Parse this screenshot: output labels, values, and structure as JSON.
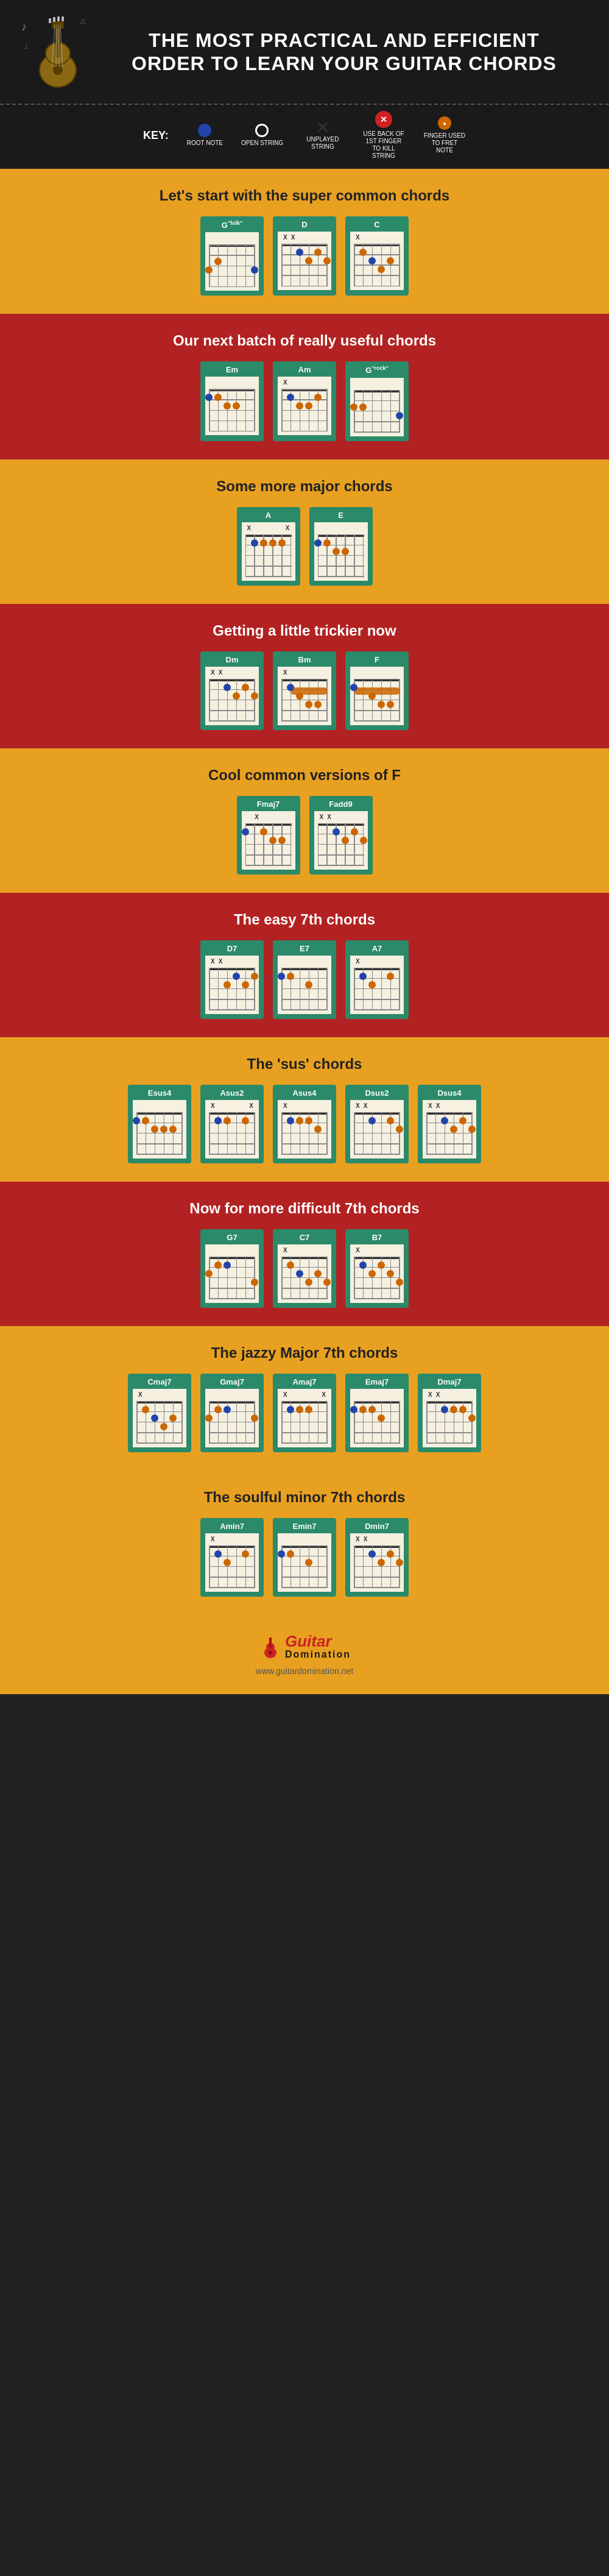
{
  "header": {
    "title": "THE MOST PRACTICAL AND EFFICIENT ORDER TO LEARN YOUR GUITAR CHORDS"
  },
  "key": {
    "label": "KEY:",
    "items": [
      {
        "id": "root-note",
        "type": "root",
        "label": "ROOT NOTE"
      },
      {
        "id": "open-string",
        "type": "open",
        "label": "OPEN STRING"
      },
      {
        "id": "unplayed",
        "type": "x",
        "label": "UNPLAYED STRING"
      },
      {
        "id": "kill-string",
        "type": "kill",
        "label": "USE BACK OF 1ST FINGER TO KILL STRING"
      },
      {
        "id": "fret-note",
        "type": "fret",
        "label": "FINGER USED TO FRET NOTE"
      }
    ]
  },
  "sections": [
    {
      "id": "super-common",
      "bg": "yellow",
      "title": "Let's start with the super common chords",
      "chords": [
        {
          "name": "G",
          "sup": "\"folk\"",
          "indicators": [
            "",
            "",
            "",
            "",
            "",
            ""
          ],
          "dots": []
        },
        {
          "name": "D",
          "sup": "",
          "indicators": [
            "X",
            "X",
            "",
            "",
            "",
            ""
          ],
          "dots": []
        },
        {
          "name": "C",
          "sup": "",
          "indicators": [
            "X",
            "",
            "",
            "",
            "",
            ""
          ],
          "dots": []
        }
      ]
    },
    {
      "id": "useful",
      "bg": "red",
      "title": "Our next batch of really useful chords",
      "chords": [
        {
          "name": "Em",
          "sup": "",
          "indicators": [
            "",
            "",
            "",
            "",
            "",
            ""
          ],
          "dots": []
        },
        {
          "name": "Am",
          "sup": "",
          "indicators": [
            "X",
            "",
            "",
            "",
            "",
            ""
          ],
          "dots": []
        },
        {
          "name": "G",
          "sup": "\"rock\"",
          "indicators": [
            "",
            "",
            "",
            "",
            "",
            ""
          ],
          "dots": []
        }
      ]
    },
    {
      "id": "major",
      "bg": "yellow",
      "title": "Some more major chords",
      "chords": [
        {
          "name": "A",
          "sup": "",
          "indicators": [
            "X",
            "",
            "",
            "",
            "",
            "X"
          ],
          "dots": []
        },
        {
          "name": "E",
          "sup": "",
          "indicators": [
            "",
            "",
            "",
            "",
            "",
            ""
          ],
          "dots": []
        }
      ]
    },
    {
      "id": "trickier",
      "bg": "red",
      "title": "Getting a little trickier now",
      "chords": [
        {
          "name": "Dm",
          "sup": "",
          "indicators": [
            "X",
            "X",
            "",
            "",
            "",
            ""
          ],
          "dots": []
        },
        {
          "name": "Bm",
          "sup": "",
          "indicators": [
            "X",
            "",
            "",
            "",
            "",
            ""
          ],
          "dots": []
        },
        {
          "name": "F",
          "sup": "",
          "indicators": [
            "",
            "",
            "",
            "",
            "",
            ""
          ],
          "dots": []
        }
      ]
    },
    {
      "id": "f-versions",
      "bg": "yellow",
      "title": "Cool common versions of F",
      "chords": [
        {
          "name": "Fmaj7",
          "sup": "",
          "indicators": [
            "",
            "X",
            "",
            "",
            "",
            ""
          ],
          "dots": []
        },
        {
          "name": "Fadd9",
          "sup": "",
          "indicators": [
            "X",
            "X",
            "",
            "",
            "",
            ""
          ],
          "dots": []
        }
      ]
    },
    {
      "id": "seventh",
      "bg": "red",
      "title": "The easy 7th chords",
      "chords": [
        {
          "name": "D7",
          "sup": "",
          "indicators": [
            "X",
            "X",
            "",
            "",
            "",
            ""
          ],
          "dots": []
        },
        {
          "name": "E7",
          "sup": "",
          "indicators": [
            "",
            "",
            "",
            "",
            "",
            ""
          ],
          "dots": []
        },
        {
          "name": "A7",
          "sup": "",
          "indicators": [
            "X",
            "",
            "",
            "",
            "",
            ""
          ],
          "dots": []
        }
      ]
    },
    {
      "id": "sus",
      "bg": "yellow",
      "title": "The 'sus' chords",
      "chords": [
        {
          "name": "Esus4",
          "sup": "",
          "indicators": [
            "",
            "",
            "",
            "",
            "",
            ""
          ],
          "dots": []
        },
        {
          "name": "Asus2",
          "sup": "",
          "indicators": [
            "X",
            "",
            "",
            "",
            "",
            "X"
          ],
          "dots": []
        },
        {
          "name": "Asus4",
          "sup": "",
          "indicators": [
            "X",
            "",
            "",
            "",
            "",
            ""
          ],
          "dots": []
        },
        {
          "name": "Dsus2",
          "sup": "",
          "indicators": [
            "X",
            "X",
            "",
            "",
            "",
            ""
          ],
          "dots": []
        },
        {
          "name": "Dsus4",
          "sup": "",
          "indicators": [
            "X",
            "X",
            "",
            "",
            "",
            ""
          ],
          "dots": []
        }
      ]
    },
    {
      "id": "seventh-hard",
      "bg": "red",
      "title": "Now for more difficult 7th chords",
      "chords": [
        {
          "name": "G7",
          "sup": "",
          "indicators": [
            "",
            "",
            "",
            "",
            "",
            ""
          ],
          "dots": []
        },
        {
          "name": "C7",
          "sup": "",
          "indicators": [
            "X",
            "",
            "",
            "",
            "",
            ""
          ],
          "dots": []
        },
        {
          "name": "B7",
          "sup": "",
          "indicators": [
            "X",
            "",
            "",
            "",
            "",
            ""
          ],
          "dots": []
        }
      ]
    },
    {
      "id": "major7",
      "bg": "yellow",
      "title": "The jazzy Major 7th chords",
      "chords": [
        {
          "name": "Cmaj7",
          "sup": "",
          "indicators": [
            "X",
            "",
            "",
            "",
            "",
            ""
          ],
          "dots": []
        },
        {
          "name": "Gmaj7",
          "sup": "",
          "indicators": [
            "",
            "",
            "",
            "",
            "",
            ""
          ],
          "dots": []
        },
        {
          "name": "Amaj7",
          "sup": "",
          "indicators": [
            "X",
            "",
            "",
            "",
            "",
            "X"
          ],
          "dots": []
        },
        {
          "name": "Emaj7",
          "sup": "",
          "indicators": [
            "",
            "",
            "",
            "",
            "",
            ""
          ],
          "dots": []
        },
        {
          "name": "Dmaj7",
          "sup": "",
          "indicators": [
            "X",
            "X",
            "",
            "",
            "",
            ""
          ],
          "dots": []
        }
      ]
    },
    {
      "id": "minor7",
      "bg": "yellow",
      "title": "The soulful minor 7th chords",
      "chords": [
        {
          "name": "Amin7",
          "sup": "",
          "indicators": [
            "X",
            "",
            "",
            "",
            "",
            ""
          ],
          "dots": []
        },
        {
          "name": "Emin7",
          "sup": "",
          "indicators": [
            "",
            "",
            "",
            "",
            "",
            ""
          ],
          "dots": []
        },
        {
          "name": "Dmin7",
          "sup": "",
          "indicators": [
            "X",
            "X",
            "",
            "",
            "",
            ""
          ],
          "dots": []
        }
      ]
    }
  ],
  "footer": {
    "logo_italic": "Guitar",
    "logo_plain": "Domination",
    "url": "www.guitardomination.net"
  }
}
